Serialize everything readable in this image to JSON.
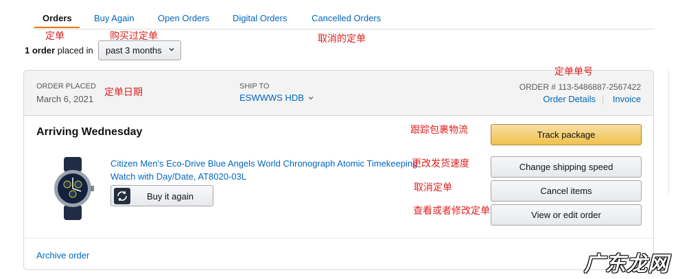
{
  "tabs": [
    {
      "label": "Orders"
    },
    {
      "label": "Buy Again"
    },
    {
      "label": "Open Orders"
    },
    {
      "label": "Digital Orders"
    },
    {
      "label": "Cancelled Orders"
    }
  ],
  "summary": {
    "count": "1 order",
    "placed_in": "placed in",
    "filter_value": "past 3 months"
  },
  "order": {
    "placed_label": "ORDER PLACED",
    "placed_date": "March 6, 2021",
    "ship_label": "SHIP TO",
    "ship_name": "ESWWWS HDB",
    "order_number": "ORDER # 113-5486887-2567422",
    "details_link": "Order Details",
    "invoice_link": "Invoice",
    "arrival": "Arriving Wednesday",
    "product_title": "Citizen Men's Eco-Drive Blue Angels World Chronograph Atomic Timekeeping Watch with Day/Date, AT8020-03L",
    "buy_again": "Buy it again",
    "actions": {
      "track": "Track package",
      "change_speed": "Change shipping speed",
      "cancel": "Cancel items",
      "view_edit": "View or edit order"
    },
    "archive": "Archive order"
  },
  "annotations": {
    "orders": "定单",
    "buy_again": "购买过定单",
    "cancelled": "取消的定单",
    "order_date": "定单日期",
    "order_number": "定单单号",
    "track": "跟踪包裹物流",
    "change_speed": "更改发货速度",
    "cancel": "取消定单",
    "view_edit": "查看或者修改定单"
  },
  "watermark": "广东龙网",
  "colors": {
    "link": "#0066c0",
    "accent": "#e77600",
    "primary_button": "#f0c14b",
    "annotation": "#e02020"
  }
}
